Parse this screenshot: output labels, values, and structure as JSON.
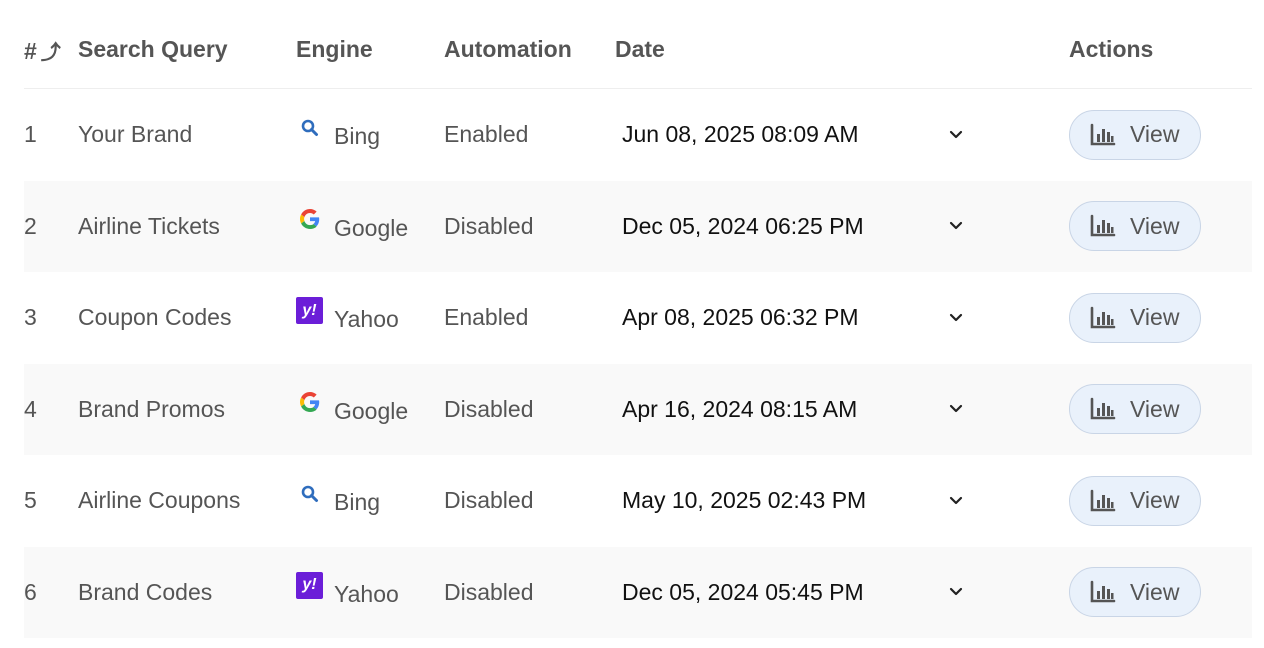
{
  "headers": {
    "num": "#",
    "sort_icon": "sort-arrow-icon",
    "query": "Search Query",
    "engine": "Engine",
    "automation": "Automation",
    "date": "Date",
    "actions": "Actions"
  },
  "rows": [
    {
      "num": "1",
      "query": "Your Brand",
      "engine": "Bing",
      "engine_icon": "bing-icon",
      "automation": "Enabled",
      "date": "Jun 08, 2025 08:09 AM",
      "action_label": "View"
    },
    {
      "num": "2",
      "query": "Airline Tickets",
      "engine": "Google",
      "engine_icon": "google-icon",
      "automation": "Disabled",
      "date": "Dec 05, 2024 06:25 PM",
      "action_label": "View"
    },
    {
      "num": "3",
      "query": "Coupon Codes",
      "engine": "Yahoo",
      "engine_icon": "yahoo-icon",
      "automation": "Enabled",
      "date": "Apr 08, 2025 06:32 PM",
      "action_label": "View"
    },
    {
      "num": "4",
      "query": "Brand Promos",
      "engine": "Google",
      "engine_icon": "google-icon",
      "automation": "Disabled",
      "date": "Apr 16, 2024 08:15 AM",
      "action_label": "View"
    },
    {
      "num": "5",
      "query": "Airline Coupons",
      "engine": "Bing",
      "engine_icon": "bing-icon",
      "automation": "Disabled",
      "date": "May 10, 2025 02:43 PM",
      "action_label": "View"
    },
    {
      "num": "6",
      "query": "Brand Codes",
      "engine": "Yahoo",
      "engine_icon": "yahoo-icon",
      "automation": "Disabled",
      "date": "Dec 05, 2024 05:45 PM",
      "action_label": "View"
    }
  ],
  "colors": {
    "bing": "#2f6dbd",
    "yahoo": "#6b1ed8",
    "button_bg": "#e9f1fb",
    "button_border": "#c9d5e6",
    "row_alt": "#f9f9f9"
  }
}
